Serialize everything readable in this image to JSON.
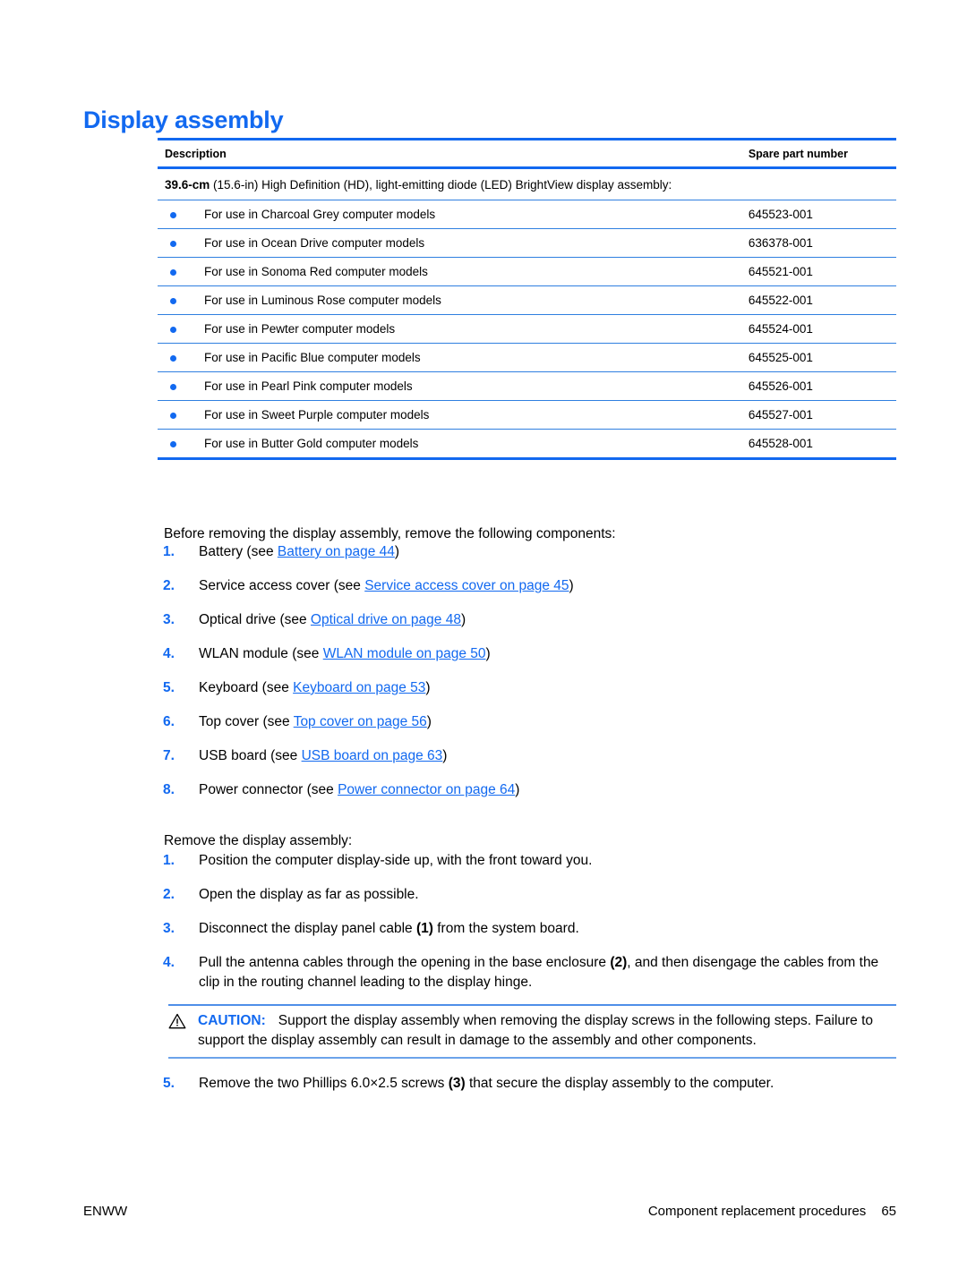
{
  "heading": "Display assembly",
  "table": {
    "columns": [
      "Description",
      "Spare part number"
    ],
    "group_label_bold": "39.6-cm",
    "group_label_rest": " (15.6-in) High Definition (HD), light-emitting diode (LED) BrightView display assembly:",
    "rows": [
      {
        "description": "For use in Charcoal Grey computer models",
        "part": "645523-001"
      },
      {
        "description": "For use in Ocean Drive computer models",
        "part": "636378-001"
      },
      {
        "description": "For use in Sonoma Red computer models",
        "part": "645521-001"
      },
      {
        "description": "For use in Luminous Rose computer models",
        "part": "645522-001"
      },
      {
        "description": "For use in Pewter computer models",
        "part": "645524-001"
      },
      {
        "description": "For use in Pacific Blue computer models",
        "part": "645525-001"
      },
      {
        "description": "For use in Pearl Pink computer models",
        "part": "645526-001"
      },
      {
        "description": "For use in Sweet Purple computer models",
        "part": "645527-001"
      },
      {
        "description": "For use in Butter Gold computer models",
        "part": "645528-001"
      }
    ]
  },
  "intro_paragraph": "Before removing the display assembly, remove the following components:",
  "prerequisites": [
    {
      "num": "1.",
      "pre": "Battery (see ",
      "link": "Battery on page 44",
      "post": ")"
    },
    {
      "num": "2.",
      "pre": "Service access cover (see ",
      "link": "Service access cover on page 45",
      "post": ")"
    },
    {
      "num": "3.",
      "pre": "Optical drive (see ",
      "link": "Optical drive on page 48",
      "post": ")"
    },
    {
      "num": "4.",
      "pre": "WLAN module (see ",
      "link": "WLAN module on page 50",
      "post": ")"
    },
    {
      "num": "5.",
      "pre": "Keyboard (see ",
      "link": "Keyboard on page 53",
      "post": ")"
    },
    {
      "num": "6.",
      "pre": "Top cover (see ",
      "link": "Top cover on page 56",
      "post": ")"
    },
    {
      "num": "7.",
      "pre": "USB board (see ",
      "link": "USB board on page 63",
      "post": ")"
    },
    {
      "num": "8.",
      "pre": "Power connector (see ",
      "link": "Power connector on page 64",
      "post": ")"
    }
  ],
  "remove_paragraph": "Remove the display assembly:",
  "steps": [
    {
      "num": "1.",
      "pre": "Position the computer display-side up, with the front toward you.",
      "callout": "",
      "post": ""
    },
    {
      "num": "2.",
      "pre": "Open the display as far as possible.",
      "callout": "",
      "post": ""
    },
    {
      "num": "3.",
      "pre": "Disconnect the display panel cable ",
      "callout": "(1)",
      "post": " from the system board."
    },
    {
      "num": "4.",
      "pre": "Pull the antenna cables through the opening in the base enclosure ",
      "callout": "(2)",
      "post": ", and then disengage the cables from the clip in the routing channel leading to the display hinge."
    }
  ],
  "caution": {
    "label": "CAUTION:",
    "text": "Support the display assembly when removing the display screws in the following steps. Failure to support the display assembly can result in damage to the assembly and other components."
  },
  "final_step": {
    "num": "5.",
    "pre": "Remove the two Phillips 6.0×2.5 screws ",
    "callout": "(3)",
    "post": " that secure the display assembly to the computer."
  },
  "footer": {
    "left": "ENWW",
    "right": "Component replacement procedures",
    "page": "65"
  },
  "colors": {
    "accent_blue": "#1269f0",
    "rule_blue": "#2f7fe0"
  }
}
